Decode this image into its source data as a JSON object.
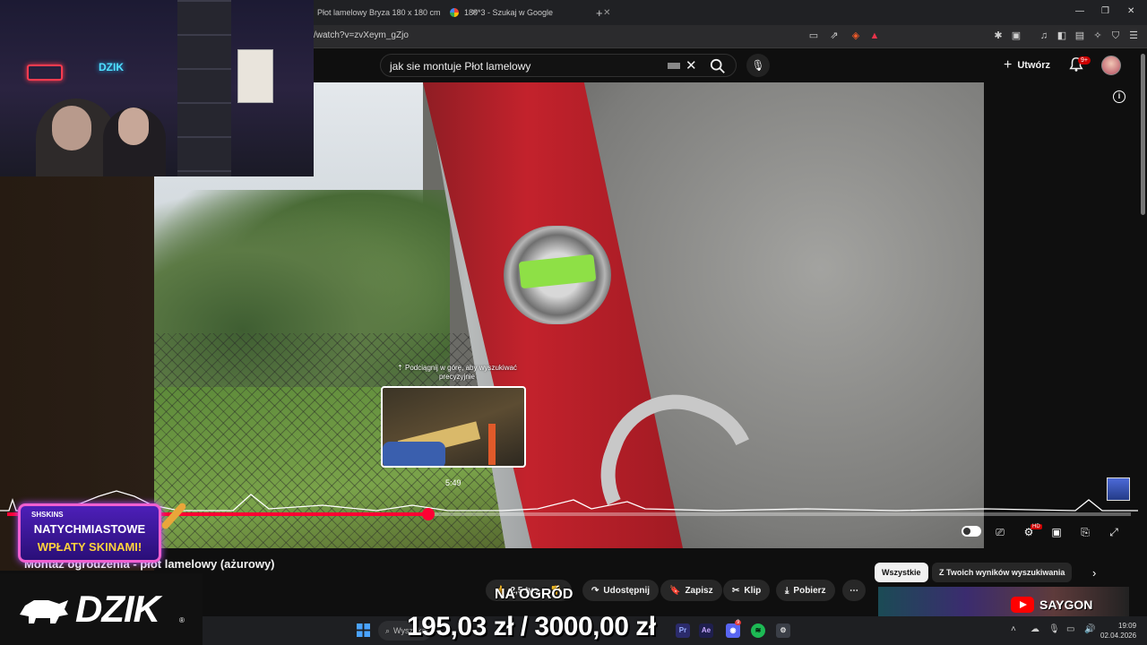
{
  "browser": {
    "tabs": [
      {
        "title": "Płot lamelowy Bryza 180 x 180 cm"
      },
      {
        "title": "180*3 - Szukaj w Google"
      }
    ],
    "new_tab_symbol": "+",
    "url": "/watch?v=zvXeym_gZjo"
  },
  "youtube": {
    "search_query": "jak sie montuje Płot lamelowy",
    "create_label": "Utwórz",
    "notification_badge": "9+",
    "video_title": "Montaż ogrodzenia - płot lamelowy (ażurowy)",
    "actions": {
      "like_count": "2,5 tys.",
      "share": "Udostępnij",
      "save": "Zapisz",
      "clip": "Klip",
      "download": "Pobierz"
    },
    "chips": [
      "Wszystkie",
      "Z Twoich wyników wyszukiwania"
    ],
    "player": {
      "preview_hint": "Podciągnij w górę, aby wyszukiwać precyzyjnie",
      "preview_time": "5:49",
      "progress_fraction": 0.375,
      "hd_badge": "HD"
    }
  },
  "stream_overlay": {
    "webcam_neon_text": "DZIK",
    "promo": {
      "brand": "SHSKINS",
      "line1": "NATYCHMIASTOWE",
      "line2": "WPŁATY SKINAMI!"
    },
    "logo_text": "DZIK",
    "logo_registered": "®",
    "donation_label": "NA OGRÓD",
    "donation_amount": "195,03 zł / 3000,00 zł",
    "partner_name": "SAYGON"
  },
  "taskbar": {
    "search_placeholder": "Wyszukaj",
    "time": "19:09",
    "date": "02.04.2026",
    "discord_badge": "9"
  },
  "colors": {
    "yt_red": "#ff0033",
    "promo_purple": "#4d1fb8",
    "promo_yellow": "#ffd23c"
  }
}
